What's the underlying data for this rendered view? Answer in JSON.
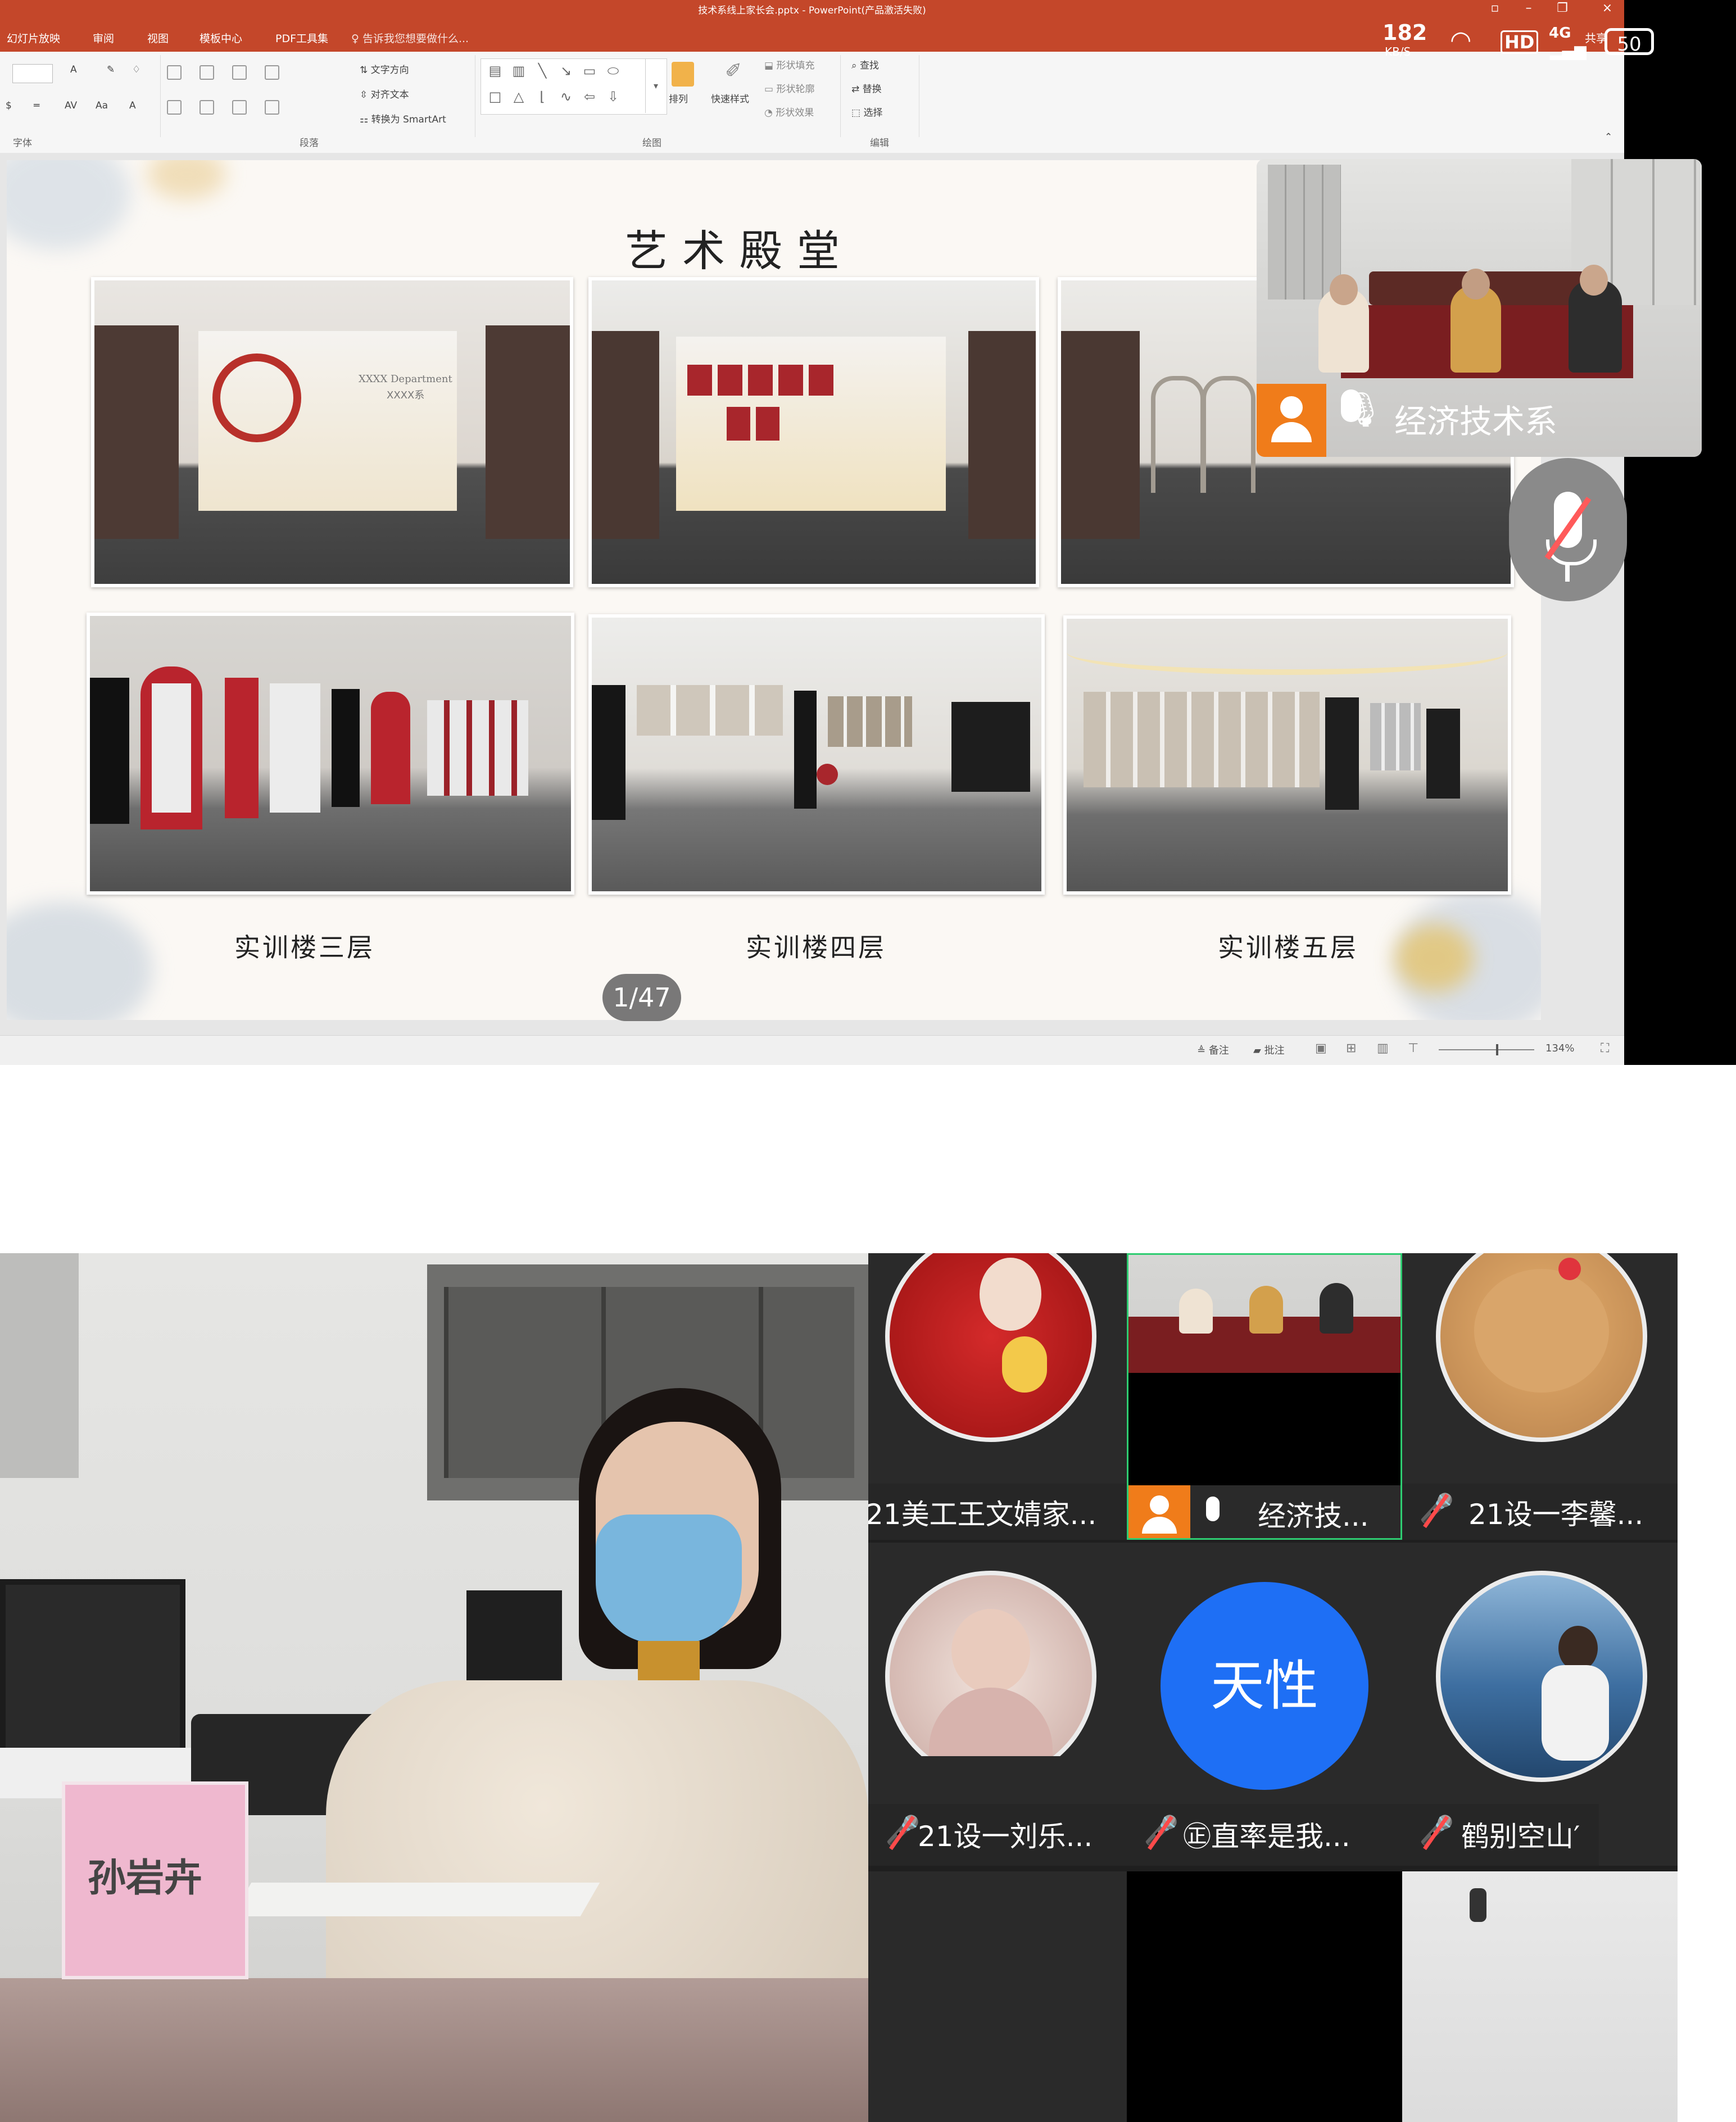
{
  "window": {
    "document_title": "技术系线上家长会.pptx - PowerPoint(产品激活失败)"
  },
  "status_bar": {
    "net_speed": "182",
    "net_unit": "KB/S",
    "hd_label": "HD",
    "network": "4G",
    "share_label": "共享",
    "battery": "50"
  },
  "menu": {
    "items": [
      "幻灯片放映",
      "审阅",
      "视图",
      "模板中心",
      "PDF工具集",
      "告诉我您想要做什么..."
    ]
  },
  "ribbon": {
    "groups": [
      "字体",
      "段落",
      "绘图",
      "编辑"
    ],
    "paragraph_buttons": [
      "文字方向",
      "对齐文本",
      "转换为 SmartArt"
    ],
    "drawing_buttons": [
      "排列",
      "快速样式",
      "形状填充",
      "形状轮廓",
      "形状效果"
    ],
    "editing_buttons": [
      "查找",
      "替换",
      "选择"
    ]
  },
  "slide": {
    "title": "艺术殿堂",
    "captions": [
      "实训楼三层",
      "实训楼四层",
      "实训楼五层"
    ],
    "counter": "1/47",
    "photo_texts": [
      "XXXX Department",
      "XXXX系"
    ]
  },
  "bottom_status": {
    "notes": "备注",
    "comments": "批注",
    "zoom": "134%"
  },
  "self_view": {
    "name": "经济技术系"
  },
  "main_camera": {
    "name_plate": "孙岩卉"
  },
  "participants": [
    {
      "name": "21美工王文婧家...",
      "muted": false,
      "avatar": "photo-dragon"
    },
    {
      "name": "经济技...",
      "muted": false,
      "avatar": "video",
      "active": true
    },
    {
      "name": "21设一李馨...",
      "muted": true,
      "avatar": "photo-cat"
    },
    {
      "name": "21设一刘乐...",
      "muted": true,
      "avatar": "photo-child"
    },
    {
      "name": "㊣直率是我...",
      "muted": true,
      "avatar": "text",
      "avatar_text": "天性"
    },
    {
      "name": "鹤别空山′",
      "muted": true,
      "avatar": "photo-beach"
    }
  ],
  "colors": {
    "ppt_red": "#c4472a",
    "avatar_blue": "#1e6ff5",
    "user_orange": "#f07c1a",
    "active_border": "#2ecc71"
  }
}
